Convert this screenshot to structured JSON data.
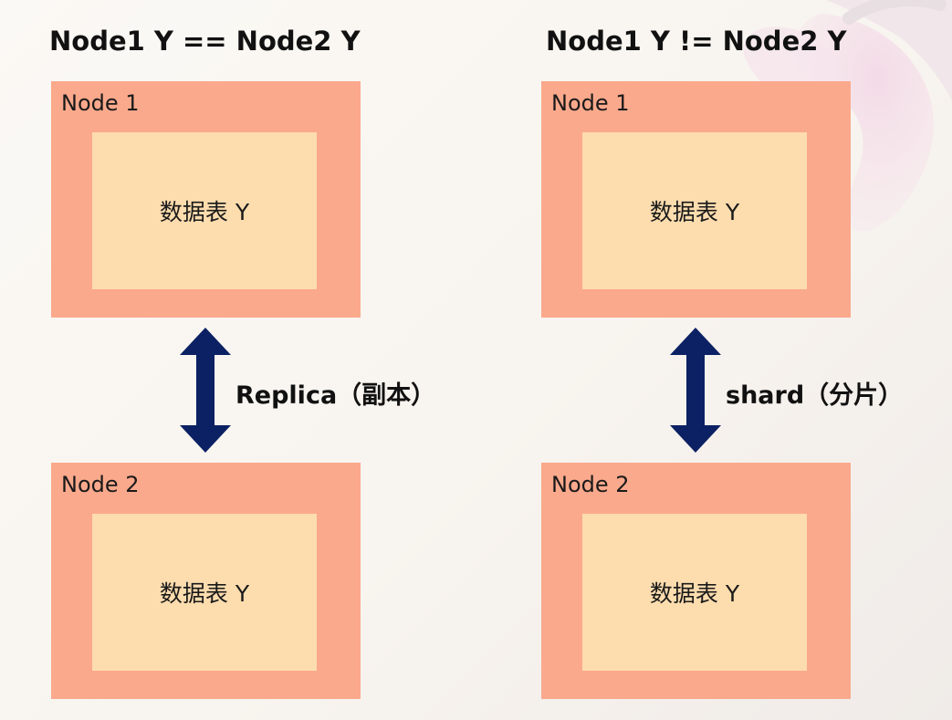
{
  "panels": [
    {
      "heading": "Node1 Y == Node2 Y",
      "relation": "Replica（副本）",
      "nodes": [
        {
          "label": "Node 1",
          "table": "数据表 Y"
        },
        {
          "label": "Node 2",
          "table": "数据表 Y"
        }
      ]
    },
    {
      "heading": "Node1 Y != Node2 Y",
      "relation": "shard（分片）",
      "nodes": [
        {
          "label": "Node 1",
          "table": "数据表 Y"
        },
        {
          "label": "Node 2",
          "table": "数据表 Y"
        }
      ]
    }
  ],
  "colors": {
    "node_fill": "#fba98c",
    "table_fill": "#fddcae",
    "arrow": "#0c2163",
    "text": "#111111"
  },
  "icons": [
    "double-headed-vertical-arrow-icon",
    "flower-decoration"
  ]
}
